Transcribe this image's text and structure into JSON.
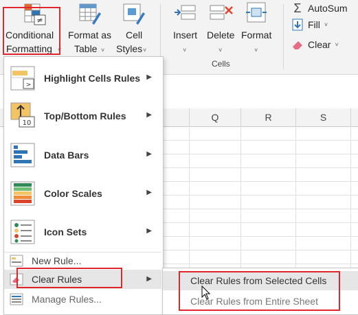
{
  "ribbon": {
    "conditional_formatting": {
      "line1": "Conditional",
      "line2": "Formatting"
    },
    "format_as_table": {
      "line1": "Format as",
      "line2": "Table"
    },
    "cell_styles": {
      "line1": "Cell",
      "line2": "Styles"
    },
    "insert": "Insert",
    "delete": "Delete",
    "format": "Format",
    "cells_group": "Cells",
    "autosum": "AutoSum",
    "fill": "Fill",
    "clear": "Clear"
  },
  "columns": [
    "Q",
    "R",
    "S"
  ],
  "menu": {
    "items": [
      {
        "label": "Highlight Cells Rules",
        "icon": "highlight-cells-rules-icon"
      },
      {
        "label": "Top/Bottom Rules",
        "icon": "top-bottom-rules-icon"
      },
      {
        "label": "Data Bars",
        "icon": "data-bars-icon"
      },
      {
        "label": "Color Scales",
        "icon": "color-scales-icon"
      },
      {
        "label": "Icon Sets",
        "icon": "icon-sets-icon"
      }
    ],
    "new_rule": "New Rule...",
    "clear_rules": "Clear Rules",
    "manage_rules": "Manage Rules..."
  },
  "submenu": {
    "selected": "Clear Rules from Selected Cells",
    "entire": "Clear Rules from Entire Sheet"
  },
  "colors": {
    "highlight_box": "#e0252b",
    "accent": "#217346"
  }
}
